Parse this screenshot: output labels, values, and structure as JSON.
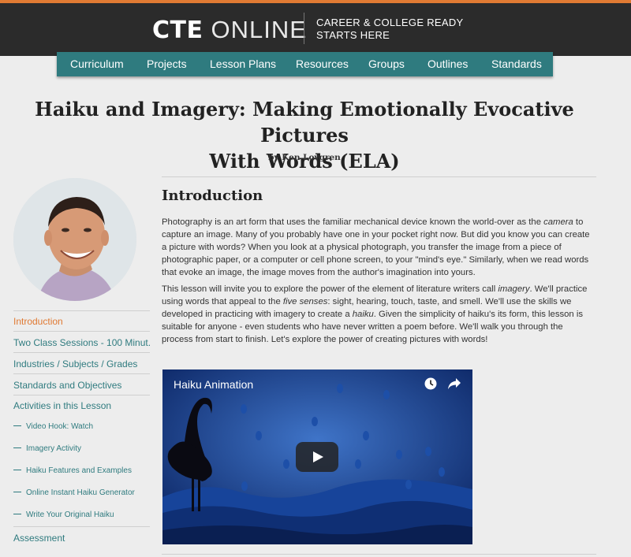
{
  "header": {
    "logo_bold": "CTE",
    "logo_light": "ONLINE",
    "tagline_line1": "CAREER & COLLEGE READY",
    "tagline_line2": "STARTS HERE"
  },
  "nav": {
    "items": [
      "Curriculum",
      "Projects",
      "Lesson Plans",
      "Resources",
      "Groups",
      "Outlines",
      "Standards"
    ]
  },
  "page": {
    "title_line1": "Haiku and Imagery: Making Emotionally Evocative Pictures",
    "title_line2": "With Words (ELA)",
    "author": "by Ken Lovgren"
  },
  "sidebar": {
    "items": [
      {
        "label": "Introduction",
        "active": true
      },
      {
        "label": "Two Class Sessions - 100 Minut..."
      },
      {
        "label": "Industries / Subjects / Grades"
      },
      {
        "label": "Standards and Objectives"
      },
      {
        "label": "Activities in this Lesson"
      },
      {
        "label": "Video Hook: Watch",
        "sub": true
      },
      {
        "label": "Imagery Activity",
        "sub": true
      },
      {
        "label": "Haiku Features and Examples",
        "sub": true
      },
      {
        "label": "Online Instant Haiku Generator",
        "sub": true
      },
      {
        "label": "Write Your Original Haiku",
        "sub": true
      },
      {
        "label": "Assessment"
      }
    ]
  },
  "intro": {
    "heading": "Introduction",
    "p1": [
      "Photography is an art form that uses the familiar mechanical device known the world-over as the ",
      "camera",
      " to capture an image. Many of you probably have one in your pocket right now. But did you know you can create a picture with words? When you look at a physical photograph, you transfer the image from a piece of photographic paper, or a computer or cell phone screen, to your \"mind's eye.\" Similarly, when we read words that evoke an image, the image moves from the author's imagination into yours."
    ],
    "p2": [
      "This lesson will invite you to explore the power of the element of literature writers call ",
      "imagery",
      ". We'll practice using words that appeal to the ",
      "five senses",
      ": sight, hearing, touch, taste, and smell. We'll use the skills we developed in practicing with imagery to create a ",
      "haiku",
      ". Given the simplicity of haiku's its form, this lesson is suitable for anyone - even students who have never written a poem before. We'll walk you through the process from start to finish. Let's explore the power of creating pictures with words!"
    ]
  },
  "video": {
    "title": "Haiku Animation",
    "icons": [
      "clock-icon",
      "share-icon",
      "play-icon"
    ]
  },
  "colors": {
    "header_bg": "#2b2b2b",
    "accent_orange": "#e07a33",
    "nav_teal": "#2f7b7f",
    "page_bg": "#ededed"
  }
}
